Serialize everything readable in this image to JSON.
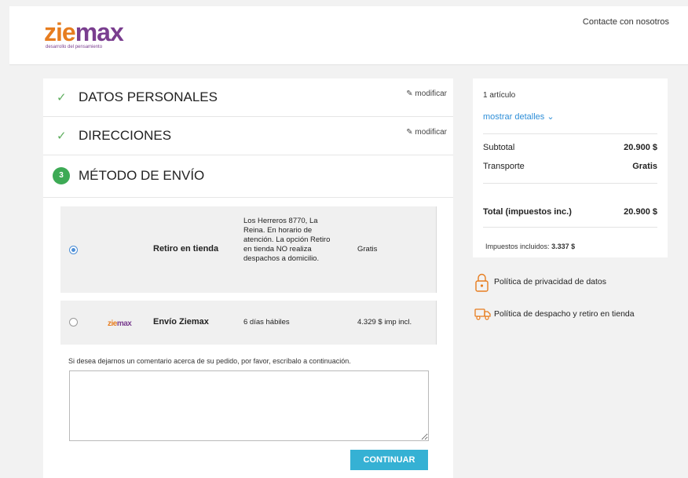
{
  "header": {
    "logo": {
      "part1": "zie",
      "part2": "max",
      "tagline": "desarrollo del pensamiento"
    },
    "contact_link": "Contacte con nosotros"
  },
  "checkout": {
    "steps": [
      {
        "title": "DATOS PERSONALES",
        "edit_label": "modificar",
        "status": "completed"
      },
      {
        "title": "DIRECCIONES",
        "edit_label": "modificar",
        "status": "completed"
      },
      {
        "number": "3",
        "title": "MÉTODO DE ENVÍO",
        "status": "active"
      }
    ],
    "shipping_options": [
      {
        "name": "Retiro en tienda",
        "description": "Los Herreros 8770, La Reina. En horario de atención. La opción Retiro en tienda NO realiza despachos a domicilio.",
        "price": "Gratis",
        "selected": true
      },
      {
        "logo": {
          "part1": "zie",
          "part2": "max"
        },
        "name": "Envío Ziemax",
        "description": "6 días hábiles",
        "price": "4.329 $ imp incl.",
        "selected": false
      }
    ],
    "comment_label": "Si desea dejarnos un comentario acerca de su pedido, por favor, escríbalo a continuación.",
    "comment_value": "",
    "continue_label": "CONTINUAR"
  },
  "summary": {
    "items_count": "1 artículo",
    "show_details": "mostrar detalles",
    "subtotal_label": "Subtotal",
    "subtotal_value": "20.900 $",
    "shipping_label": "Transporte",
    "shipping_value": "Gratis",
    "total_label": "Total (impuestos inc.)",
    "total_value": "20.900 $",
    "tax_label": "Impuestos incluidos:",
    "tax_value": "3.337 $"
  },
  "policies": [
    {
      "label": "Política de privacidad de datos",
      "icon": "lock-icon"
    },
    {
      "label": "Política de despacho y retiro en tienda",
      "icon": "truck-icon"
    }
  ],
  "colors": {
    "accent_orange": "#e77d1f",
    "brand_purple": "#7a3e8f",
    "success_green": "#3daa55",
    "link_blue": "#2f8fd8",
    "button_blue": "#35b1d4"
  }
}
